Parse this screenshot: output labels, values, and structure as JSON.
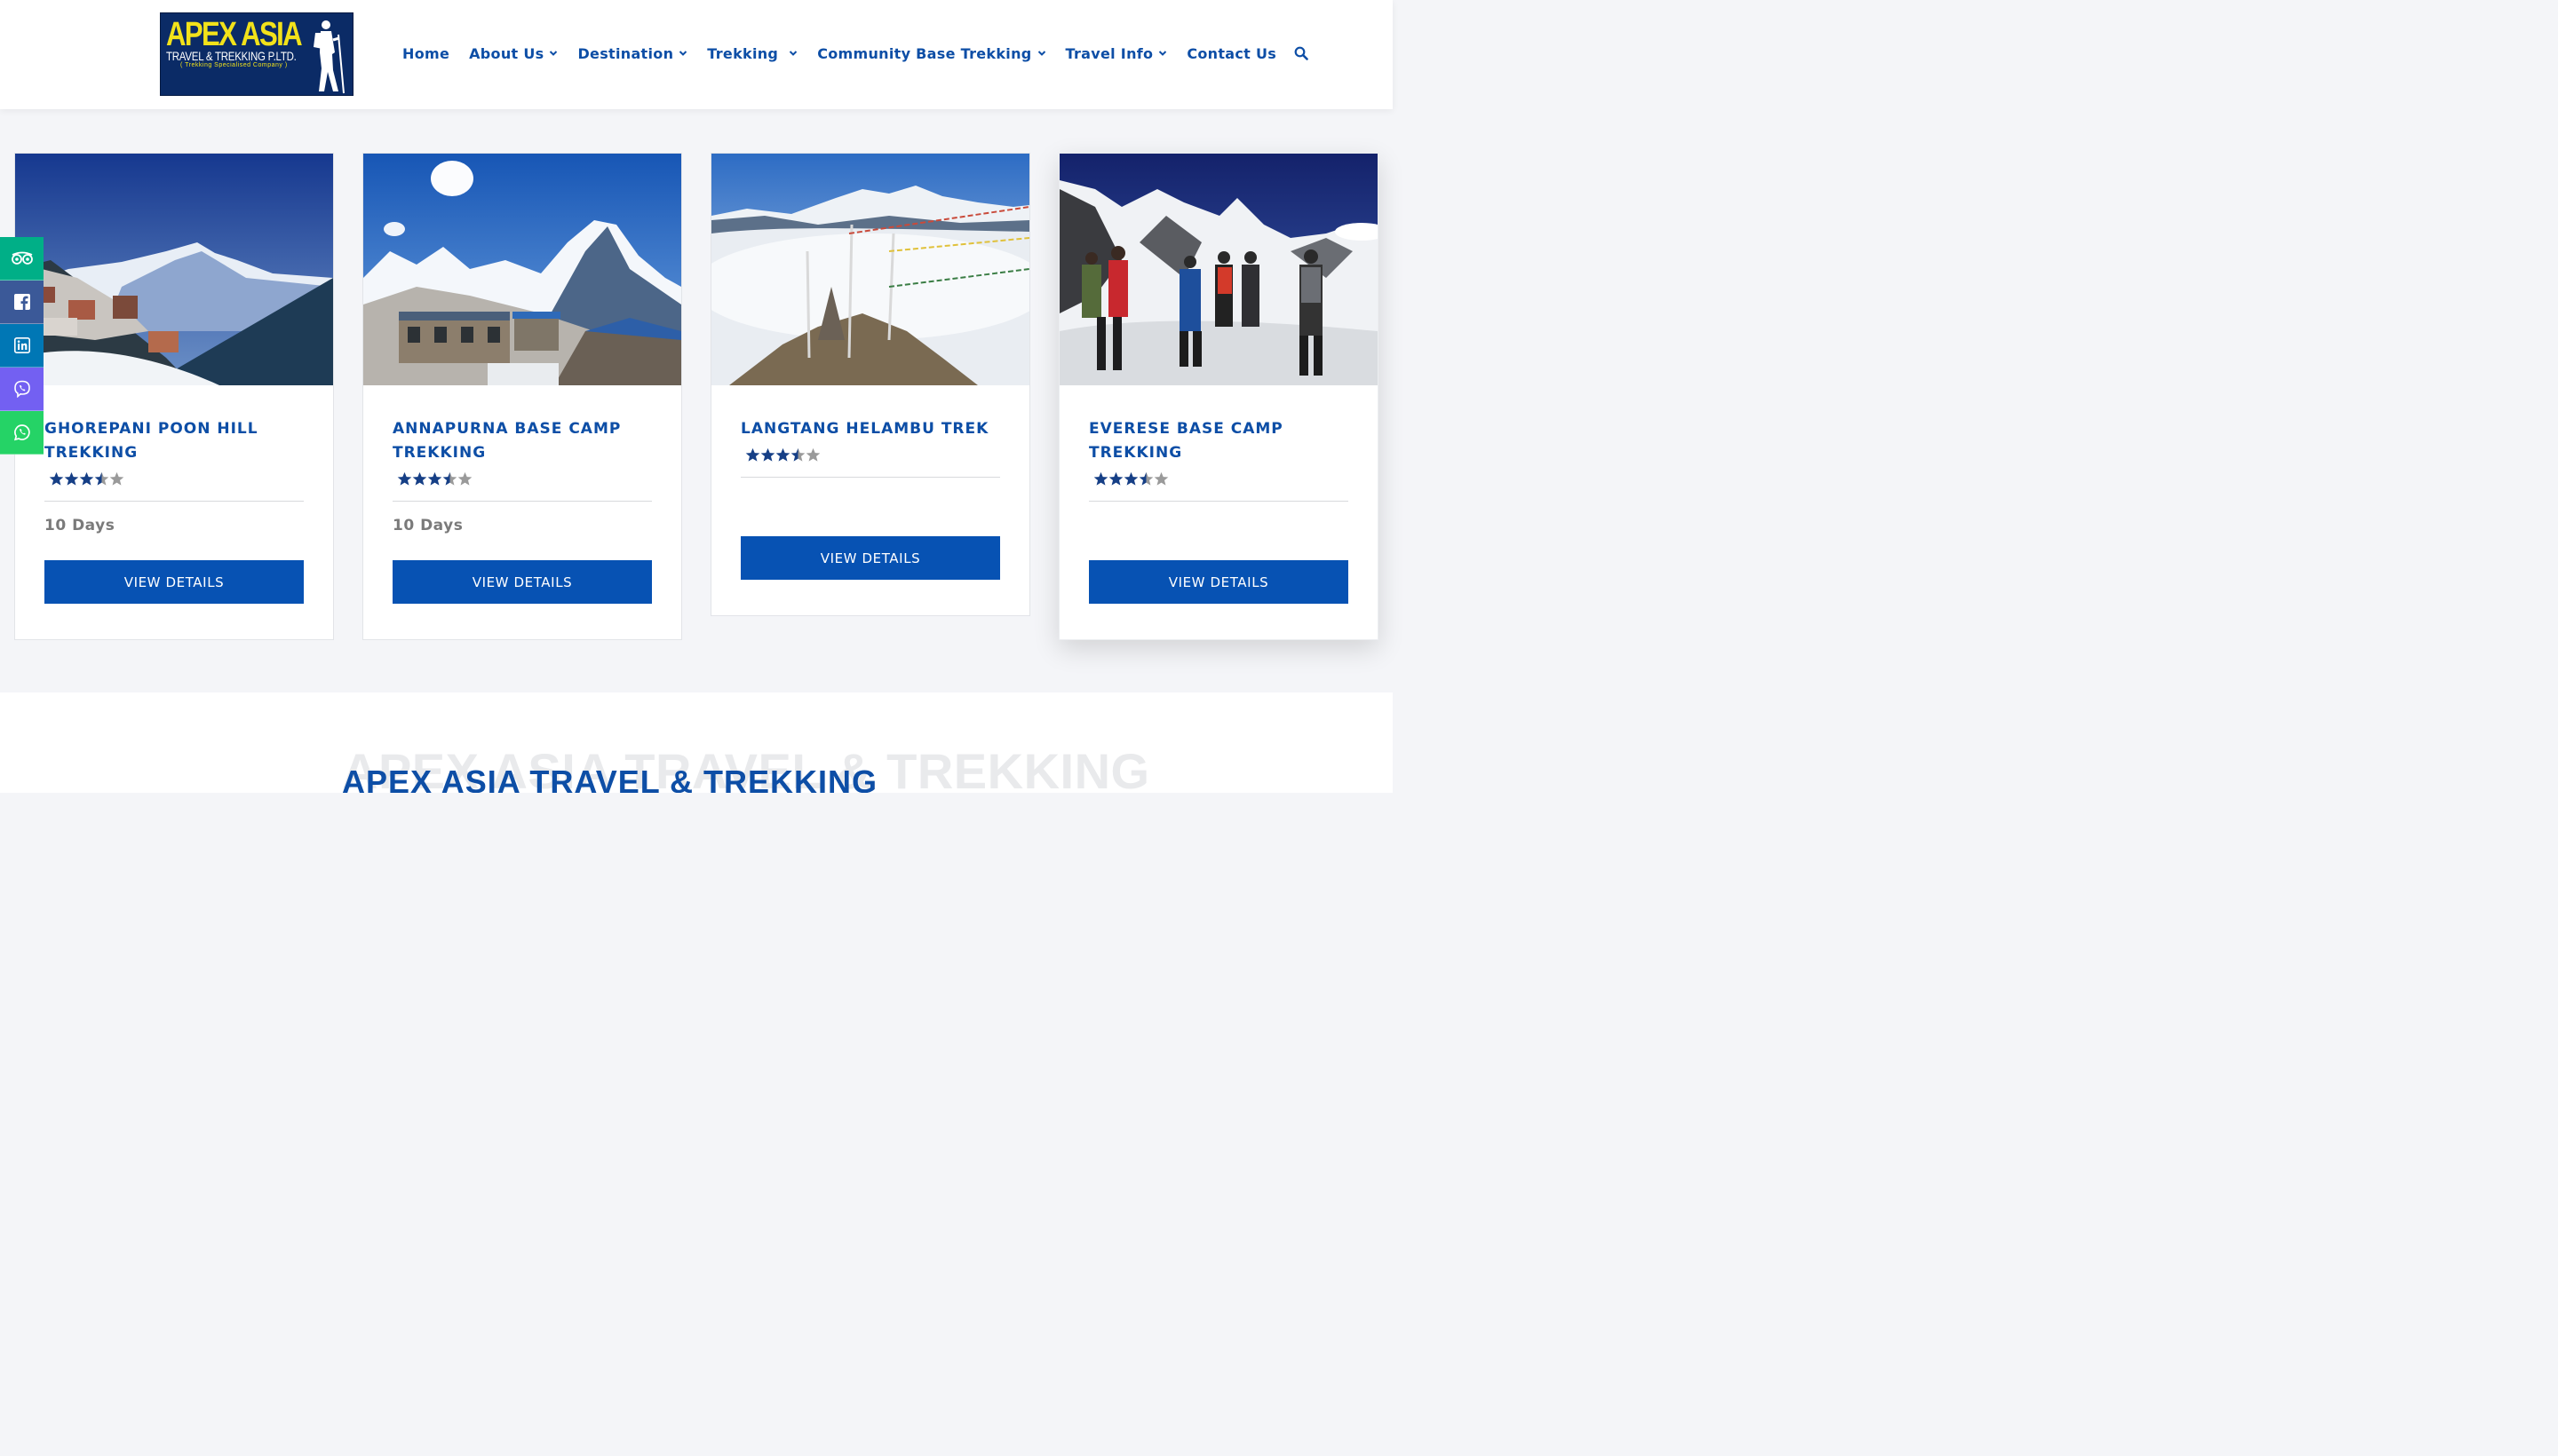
{
  "brand": {
    "logo_main": "APEX ASIA",
    "logo_sub": "TRAVEL & TREKKING P.LTD.",
    "logo_tag": "( Trekking Specialised Company )",
    "primary_color": "#0d4ea6",
    "button_color": "#0752b3"
  },
  "nav": {
    "items": [
      {
        "label": "Home",
        "dropdown": false
      },
      {
        "label": "About Us",
        "dropdown": true
      },
      {
        "label": "Destination",
        "dropdown": true
      },
      {
        "label": "Trekking",
        "dropdown": true
      },
      {
        "label": "Community Base Trekking",
        "dropdown": true
      },
      {
        "label": "Travel Info",
        "dropdown": true
      },
      {
        "label": "Contact Us",
        "dropdown": false
      }
    ],
    "search_icon": "search-icon"
  },
  "social": [
    {
      "name": "tripadvisor-icon",
      "color": "#00af87"
    },
    {
      "name": "facebook-icon",
      "color": "#3b5998"
    },
    {
      "name": "linkedin-icon",
      "color": "#0077b5"
    },
    {
      "name": "viber-icon",
      "color": "#7360f2"
    },
    {
      "name": "whatsapp-icon",
      "color": "#25d366"
    }
  ],
  "cards": [
    {
      "title": "GHOREPANI POON HILL TREKKING",
      "rating": 3.5,
      "days": "10 Days",
      "button": "VIEW DETAILS"
    },
    {
      "title": "ANNAPURNA BASE CAMP TREKKING",
      "rating": 3.5,
      "days": "10 Days",
      "button": "VIEW DETAILS"
    },
    {
      "title": "LANGTANG HELAMBU TREK",
      "rating": 3.5,
      "days": "",
      "button": "VIEW DETAILS"
    },
    {
      "title": "EVERESE BASE CAMP TREKKING",
      "rating": 3.5,
      "days": "",
      "button": "VIEW DETAILS"
    }
  ],
  "section": {
    "ghost_text": "APEX ASIA TRAVEL & TREKKING",
    "headline": "APEX ASIA TRAVEL & TREKKING"
  }
}
